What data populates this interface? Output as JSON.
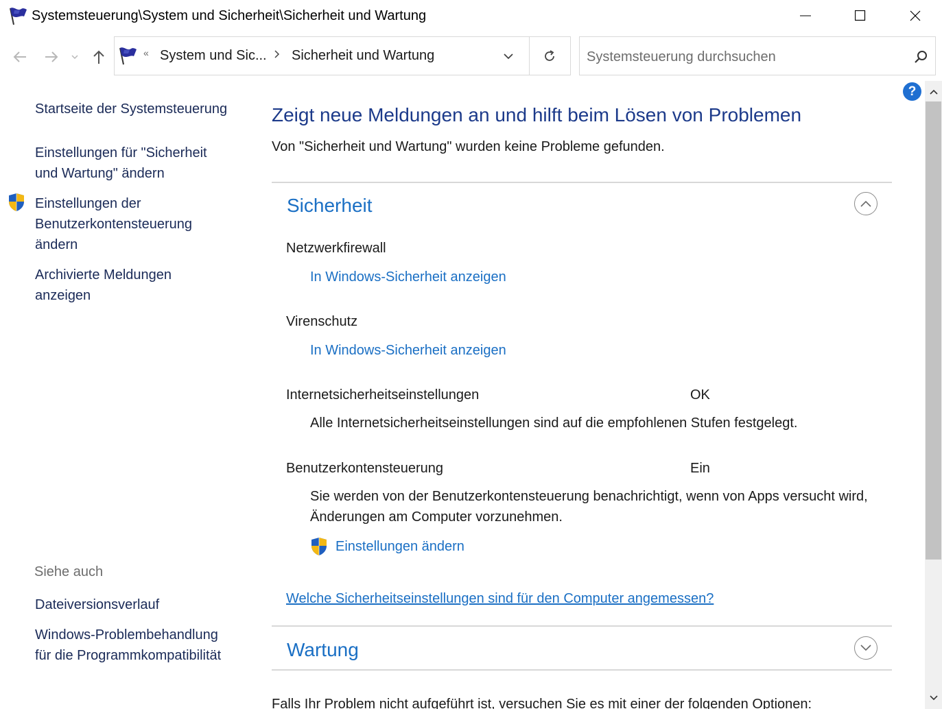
{
  "window": {
    "title": "Systemsteuerung\\System und Sicherheit\\Sicherheit und Wartung"
  },
  "nav": {
    "breadcrumb": [
      "System und Sic...",
      "Sicherheit und Wartung"
    ],
    "search_placeholder": "Systemsteuerung durchsuchen"
  },
  "help": {
    "label": "?"
  },
  "sidebar": {
    "items": [
      {
        "label": "Startseite der Systemsteuerung"
      },
      {
        "label": "Einstellungen für \"Sicherheit und Wartung\" ändern"
      },
      {
        "label": "Einstellungen der Benutzerkontensteuerung ändern"
      },
      {
        "label": "Archivierte Meldungen anzeigen"
      }
    ],
    "see_also": {
      "heading": "Siehe auch",
      "items": [
        {
          "label": "Dateiversionsverlauf"
        },
        {
          "label": "Windows-Problembehandlung für die Programmkompatibilität"
        }
      ]
    }
  },
  "main": {
    "title": "Zeigt neue Meldungen an und hilft beim Lösen von Problemen",
    "subtitle": "Von \"Sicherheit und Wartung\" wurden keine Probleme gefunden.",
    "security": {
      "heading": "Sicherheit",
      "items": [
        {
          "label": "Netzwerkfirewall",
          "link": "In Windows-Sicherheit anzeigen"
        },
        {
          "label": "Virenschutz",
          "link": "In Windows-Sicherheit anzeigen"
        },
        {
          "label": "Internetsicherheitseinstellungen",
          "status": "OK",
          "description": "Alle Internetsicherheitseinstellungen sind auf die empfohlenen Stufen festgelegt."
        },
        {
          "label": "Benutzerkontensteuerung",
          "status": "Ein",
          "description": "Sie werden von der Benutzerkontensteuerung benachrichtigt, wenn von Apps versucht wird, Änderungen am Computer vorzunehmen.",
          "link": "Einstellungen ändern"
        }
      ],
      "question_link": "Welche Sicherheitseinstellungen sind für den Computer angemessen?"
    },
    "maintenance": {
      "heading": "Wartung"
    },
    "footer": "Falls Ihr Problem nicht aufgeführt ist, versuchen Sie es mit einer der folgenden Optionen:"
  },
  "colors": {
    "link": "#1a6fc4",
    "title": "#1c3a8a",
    "help": "#1f6fd1"
  }
}
